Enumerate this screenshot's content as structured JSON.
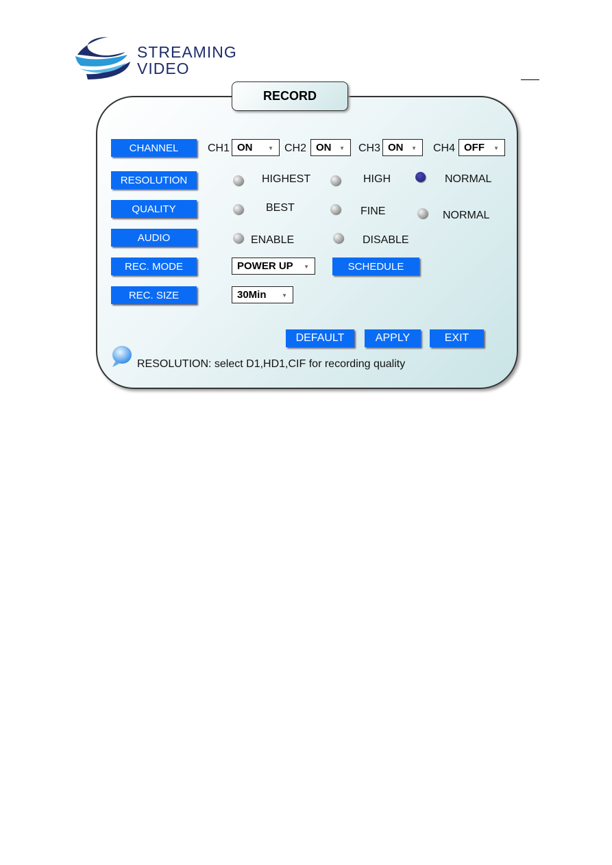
{
  "logo": {
    "line1": "STREAMING",
    "line2": "VIDEO"
  },
  "title": "RECORD",
  "channel": {
    "label": "CHANNEL",
    "channels": [
      {
        "name": "CH1",
        "value": "ON"
      },
      {
        "name": "CH2",
        "value": "ON"
      },
      {
        "name": "CH3",
        "value": "ON"
      },
      {
        "name": "CH4",
        "value": "OFF"
      }
    ]
  },
  "resolution": {
    "label": "RESOLUTION",
    "options": [
      "HIGHEST",
      "HIGH",
      "NORMAL"
    ],
    "selected": "NORMAL"
  },
  "quality": {
    "label": "QUALITY",
    "options": [
      "BEST",
      "FINE",
      "NORMAL"
    ],
    "selected": null
  },
  "audio": {
    "label": "AUDIO",
    "options": [
      "ENABLE",
      "DISABLE"
    ],
    "selected": null
  },
  "rec_mode": {
    "label": "REC. MODE",
    "value": "POWER UP",
    "schedule_label": "SCHEDULE"
  },
  "rec_size": {
    "label": "REC. SIZE",
    "value": "30Min"
  },
  "actions": {
    "default": "DEFAULT",
    "apply": "APPLY",
    "exit": "EXIT"
  },
  "tip": "RESOLUTION: select D1,HD1,CIF for recording quality",
  "colors": {
    "button": "#0a6cf5",
    "selected_radio": "#1a1a7a"
  }
}
